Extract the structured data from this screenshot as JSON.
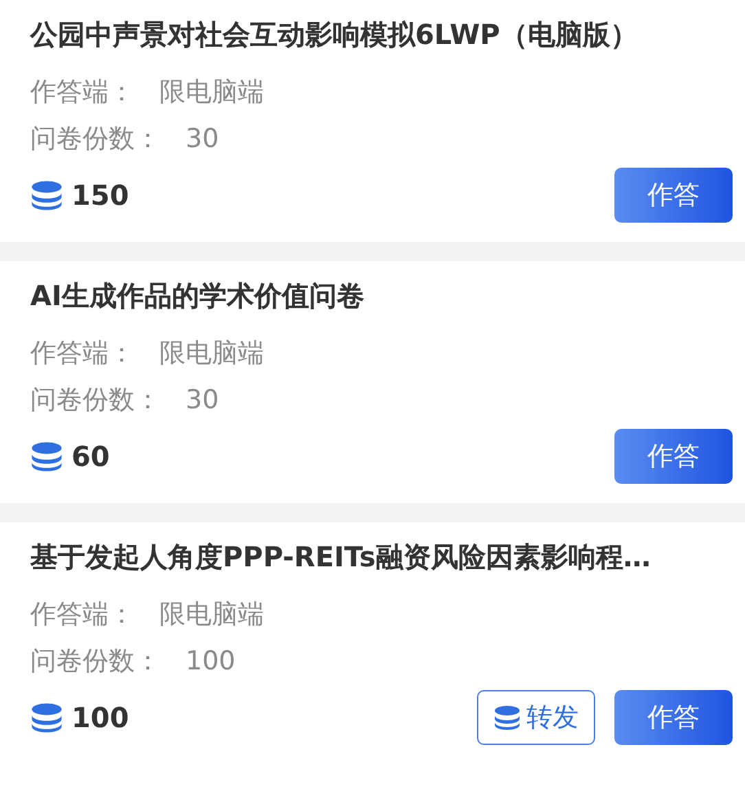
{
  "surveys": [
    {
      "title": "公园中声景对社会互动影响模拟6LWP（电脑版）",
      "fields": [
        {
          "label": "作答端：",
          "value": "限电脑端"
        },
        {
          "label": "问卷份数：",
          "value": "30"
        }
      ],
      "points": "150",
      "buttons": [
        {
          "kind": "primary",
          "label": "作答"
        }
      ]
    },
    {
      "title": "AI生成作品的学术价值问卷",
      "fields": [
        {
          "label": "作答端：",
          "value": "限电脑端"
        },
        {
          "label": "问卷份数：",
          "value": "30"
        }
      ],
      "points": "60",
      "buttons": [
        {
          "kind": "primary",
          "label": "作答"
        }
      ]
    },
    {
      "title": "基于发起人角度PPP-REITs融资风险因素影响程…",
      "fields": [
        {
          "label": "作答端：",
          "value": "限电脑端"
        },
        {
          "label": "问卷份数：",
          "value": "100"
        }
      ],
      "points": "100",
      "buttons": [
        {
          "kind": "share",
          "label": "转发"
        },
        {
          "kind": "primary",
          "label": "作答"
        }
      ]
    }
  ]
}
